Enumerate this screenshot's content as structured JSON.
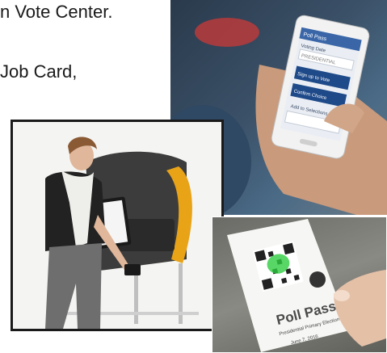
{
  "text_fragments": {
    "line1": "n Vote Center.",
    "line2": "Job Card,"
  },
  "phone_screen": {
    "app_title": "Poll Pass",
    "field1_label": "Voting Date",
    "field1_value": "PRESIDENTIAL",
    "item2": "Sign up to Vote",
    "item3": "Confirm Choice",
    "item4": "Add to Selections"
  },
  "poll_pass_card": {
    "title": "Poll Pass",
    "subtitle": "Presidential Primary Election",
    "date": "June 7, 2016"
  },
  "colors": {
    "booth_accent": "#e8a317",
    "qr_accent": "#2ecc40",
    "phone_header": "#3a66a8"
  }
}
